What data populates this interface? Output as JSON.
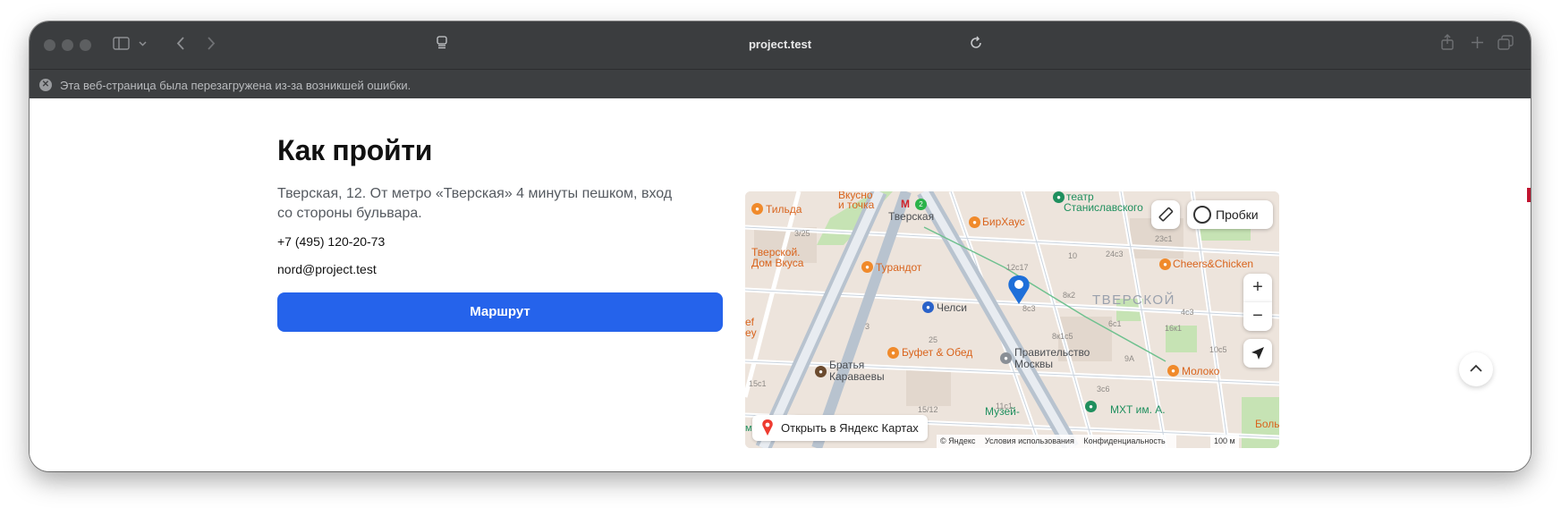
{
  "browser": {
    "url": "project.test",
    "reload_notice": "Эта веб-страница была перезагружена из-за возникшей ошибки.",
    "icons": [
      "sidebar-icon",
      "chevron-down-icon",
      "back-icon",
      "forward-icon",
      "reader-icon",
      "reload-icon",
      "share-icon",
      "new-tab-icon",
      "tabs-overview-icon"
    ]
  },
  "page": {
    "title": "Как пройти",
    "address": "Тверская, 12. От метро «Тверская» 4 минуты пешком, вход со стороны бульвара.",
    "phone": "+7 (495) 120-20-73",
    "email": "nord@project.test",
    "route_button": "Маршрут"
  },
  "map": {
    "traffic_label": "Пробки",
    "zoom_in": "+",
    "zoom_out": "−",
    "open_label": "Открыть в Яндекс Картах",
    "copyright": "© Яндекс",
    "terms": "Условия использования",
    "privacy": "Конфиденциальность",
    "scale": "100 м",
    "district": "ТВЕРСКОЙ",
    "labels": {
      "tilda": "Тильда",
      "vkusno": "Вкусно",
      "vkusno2": "и точка",
      "tverskaya_metro": "Тверская",
      "metro_line": "2",
      "teatr": "театр",
      "teatr2": "Станиславского",
      "birhaus": "БирХаус",
      "tverskoy_dom": "Тверской.",
      "tverskoy_dom2": "Дом Вкуса",
      "turandot": "Турандот",
      "cheers": "Cheers&Chicken",
      "chelsi": "Челси",
      "bufet": "Буфет & Обед",
      "pravitelstvo": "Правительство",
      "pravitelstvo2": "Москвы",
      "bratya": "Братья",
      "bratya2": "Караваевы",
      "moloko": "Молоко",
      "muzei": "Музей-",
      "mxt": "МХТ им. А.",
      "chef": "ef",
      "chef2": "ey",
      "bolsh": "Боль",
      "muzei_m": "музей М"
    },
    "house_numbers": [
      "3/25",
      "12с17",
      "10",
      "24с3",
      "23с1",
      "8с3",
      "8к2",
      "6с1",
      "16к1",
      "8к1с5",
      "9А",
      "10с5",
      "4с3",
      "15с1",
      "3с6",
      "11с1",
      "3",
      "25",
      "15/12"
    ],
    "colors": {
      "land": "#ede4dc",
      "road": "#ffffff",
      "major_road": "#b8c3cf",
      "park": "#c6e3b4",
      "marker": "#1e6fd9",
      "route_button": "#2563eb"
    }
  }
}
